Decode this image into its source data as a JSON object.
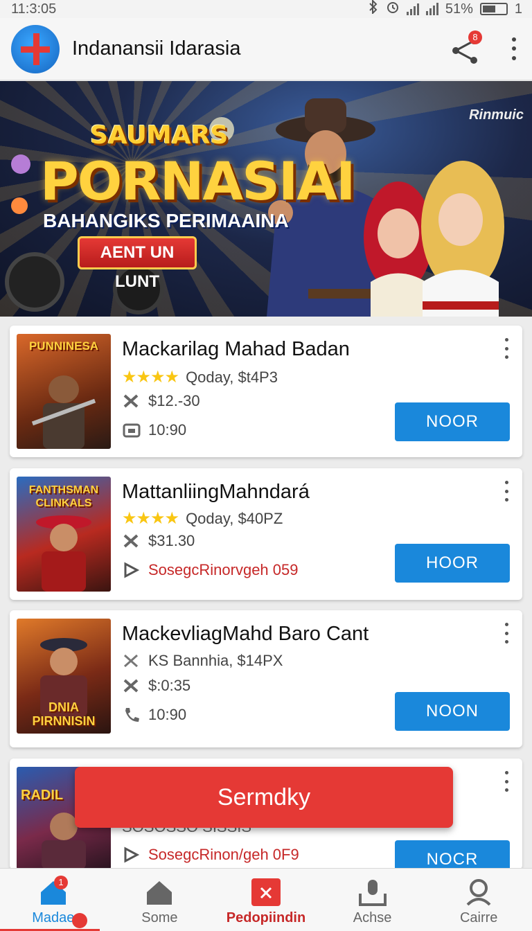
{
  "status_bar": {
    "time": "11:3:05",
    "battery": "51%",
    "extra": "1"
  },
  "app_bar": {
    "title": "Indanansii Idarasia",
    "share_badge": "8"
  },
  "banner": {
    "top_text": "SAUMARS",
    "title": "PORNASIAI",
    "subtitle": "BAHANGIKS PERIMAAINA",
    "cta": "AENT UN LUNT",
    "corner_logo": "Rinmuic"
  },
  "cards": [
    {
      "thumb_label": "PUNNINESA",
      "title": "Mackarilag Mahad Badan",
      "stars": "★★★★",
      "meta": "Qoday, $t4P3",
      "price": "$12.-30",
      "detail": "10:90",
      "button": "NOOR"
    },
    {
      "thumb_label": "FANTHSMAN CLINKALS",
      "title": "MattanliingMahndará",
      "stars": "★★★★",
      "meta": "Qoday, $40PZ",
      "price": "$31.30",
      "detail": "SosegcRinorvgeh 059",
      "button": "HOOR"
    },
    {
      "thumb_label": "DNIA PIRNNISIN",
      "title": "MackevliagMahd Baro Cant",
      "meta": "KS Bannhia, $14PX",
      "price": "$:0:35",
      "detail": "10:90",
      "button": "NOON"
    },
    {
      "thumb_label": "RADIL",
      "meta": "SOSOSSO SISSIS",
      "detail": "SosegcRinon/geh 0F9",
      "button": "NOCR"
    }
  ],
  "toast": {
    "text": "Sermdky"
  },
  "bottom_nav": [
    {
      "label": "Madae",
      "badge": "1"
    },
    {
      "label": "Some"
    },
    {
      "label": "Pedopiindin"
    },
    {
      "label": "Achse"
    },
    {
      "label": "Cairre"
    }
  ],
  "colors": {
    "accent_blue": "#1a88db",
    "accent_red": "#e53935",
    "star": "#f9c613"
  }
}
